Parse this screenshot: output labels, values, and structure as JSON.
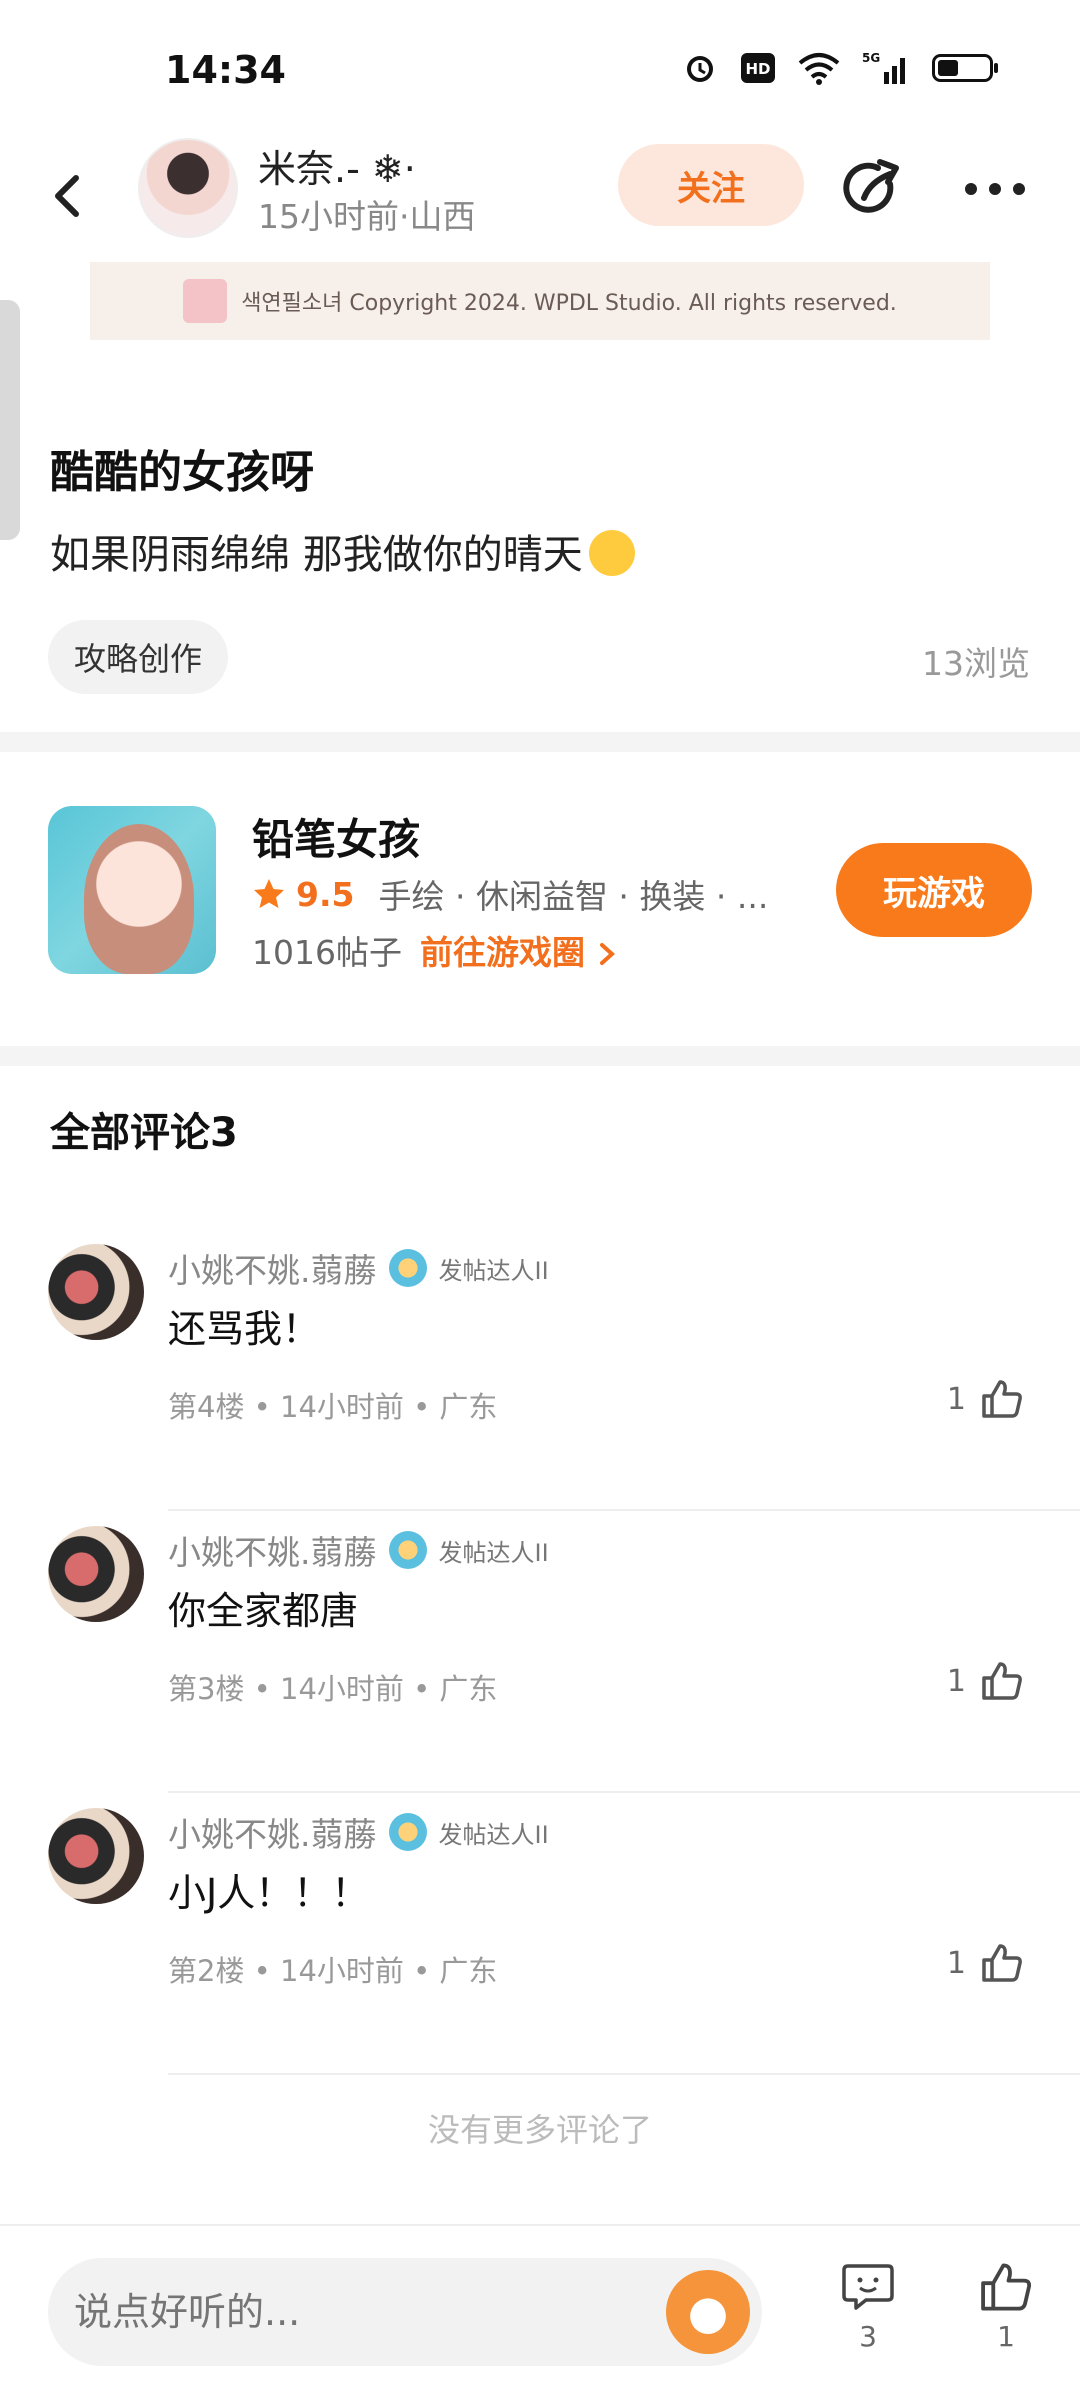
{
  "status_bar": {
    "time": "14:34"
  },
  "header": {
    "author_name": "米奈.- ❄·",
    "author_meta": "15小时前·山西",
    "follow_label": "关注"
  },
  "banner": {
    "text": "색연필소녀 Copyright 2024. WPDL Studio. All rights reserved."
  },
  "post": {
    "title": "酷酷的女孩呀",
    "body": "如果阴雨绵绵 那我做你的晴天",
    "tag": "攻略创作",
    "views": "13浏览"
  },
  "game": {
    "name": "铅笔女孩",
    "rating": "9.5",
    "genres": "手绘 · 休闲益智 · 换装 · ...",
    "posts": "1016帖子",
    "goto_label": "前往游戏圈",
    "play_label": "玩游戏"
  },
  "comments": {
    "header": "全部评论3",
    "items": [
      {
        "user": "小姚不姚.蒻蕂",
        "badge": "发帖达人II",
        "text": "还骂我！",
        "meta": "第4楼 • 14小时前 • 广东",
        "likes": "1"
      },
      {
        "user": "小姚不姚.蒻蕂",
        "badge": "发帖达人II",
        "text": "你全家都唐",
        "meta": "第3楼 • 14小时前 • 广东",
        "likes": "1"
      },
      {
        "user": "小姚不姚.蒻蕂",
        "badge": "发帖达人II",
        "text": "小J人！！！",
        "meta": "第2楼 • 14小时前 • 广东",
        "likes": "1"
      }
    ],
    "no_more": "没有更多评论了"
  },
  "bottom_bar": {
    "input_placeholder": "说点好听的...",
    "comment_count": "3",
    "like_count": "1"
  },
  "colors": {
    "accent": "#f97a1a",
    "accent_soft": "#fde7dc"
  },
  "icons": [
    "alarm-icon",
    "hd-icon",
    "wifi-icon",
    "signal-5g-icon",
    "battery-icon",
    "back-icon",
    "share-icon",
    "more-icon",
    "star-icon",
    "chevron-right-icon",
    "thumbs-up-icon",
    "comment-icon"
  ]
}
